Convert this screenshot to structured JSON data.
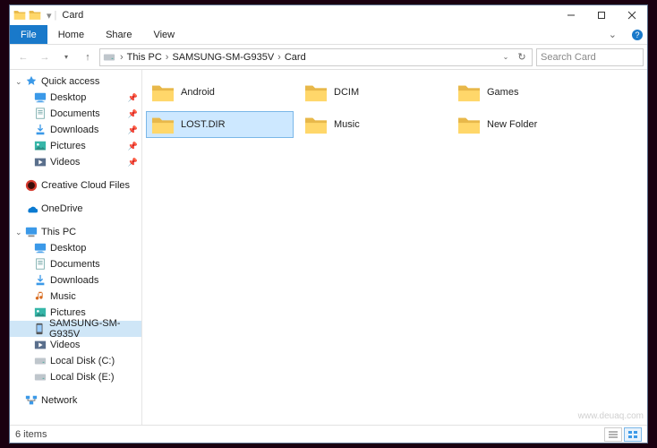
{
  "titlebar": {
    "title": "Card"
  },
  "ribbon": {
    "file": "File",
    "home": "Home",
    "share": "Share",
    "view": "View"
  },
  "breadcrumbs": [
    "This PC",
    "SAMSUNG-SM-G935V",
    "Card"
  ],
  "search": {
    "placeholder": "Search Card"
  },
  "quick_access": {
    "label": "Quick access",
    "items": [
      {
        "label": "Desktop",
        "icon": "desktop"
      },
      {
        "label": "Documents",
        "icon": "documents"
      },
      {
        "label": "Downloads",
        "icon": "downloads"
      },
      {
        "label": "Pictures",
        "icon": "pictures"
      },
      {
        "label": "Videos",
        "icon": "videos"
      }
    ]
  },
  "sidebar_items": [
    {
      "label": "Creative Cloud Files",
      "icon": "cc"
    },
    {
      "label": "OneDrive",
      "icon": "onedrive"
    }
  ],
  "thispc": {
    "label": "This PC",
    "items": [
      {
        "label": "Desktop",
        "icon": "desktop"
      },
      {
        "label": "Documents",
        "icon": "documents"
      },
      {
        "label": "Downloads",
        "icon": "downloads"
      },
      {
        "label": "Music",
        "icon": "music"
      },
      {
        "label": "Pictures",
        "icon": "pictures"
      },
      {
        "label": "SAMSUNG-SM-G935V",
        "icon": "phone",
        "selected": true
      },
      {
        "label": "Videos",
        "icon": "videos"
      },
      {
        "label": "Local Disk (C:)",
        "icon": "disk"
      },
      {
        "label": "Local Disk (E:)",
        "icon": "disk"
      }
    ]
  },
  "network": {
    "label": "Network"
  },
  "folders": [
    {
      "label": "Android"
    },
    {
      "label": "DCIM"
    },
    {
      "label": "Games"
    },
    {
      "label": "LOST.DIR",
      "selected": true
    },
    {
      "label": "Music"
    },
    {
      "label": "New Folder"
    }
  ],
  "status": {
    "text": "6 items"
  },
  "watermark": "www.deuaq.com"
}
